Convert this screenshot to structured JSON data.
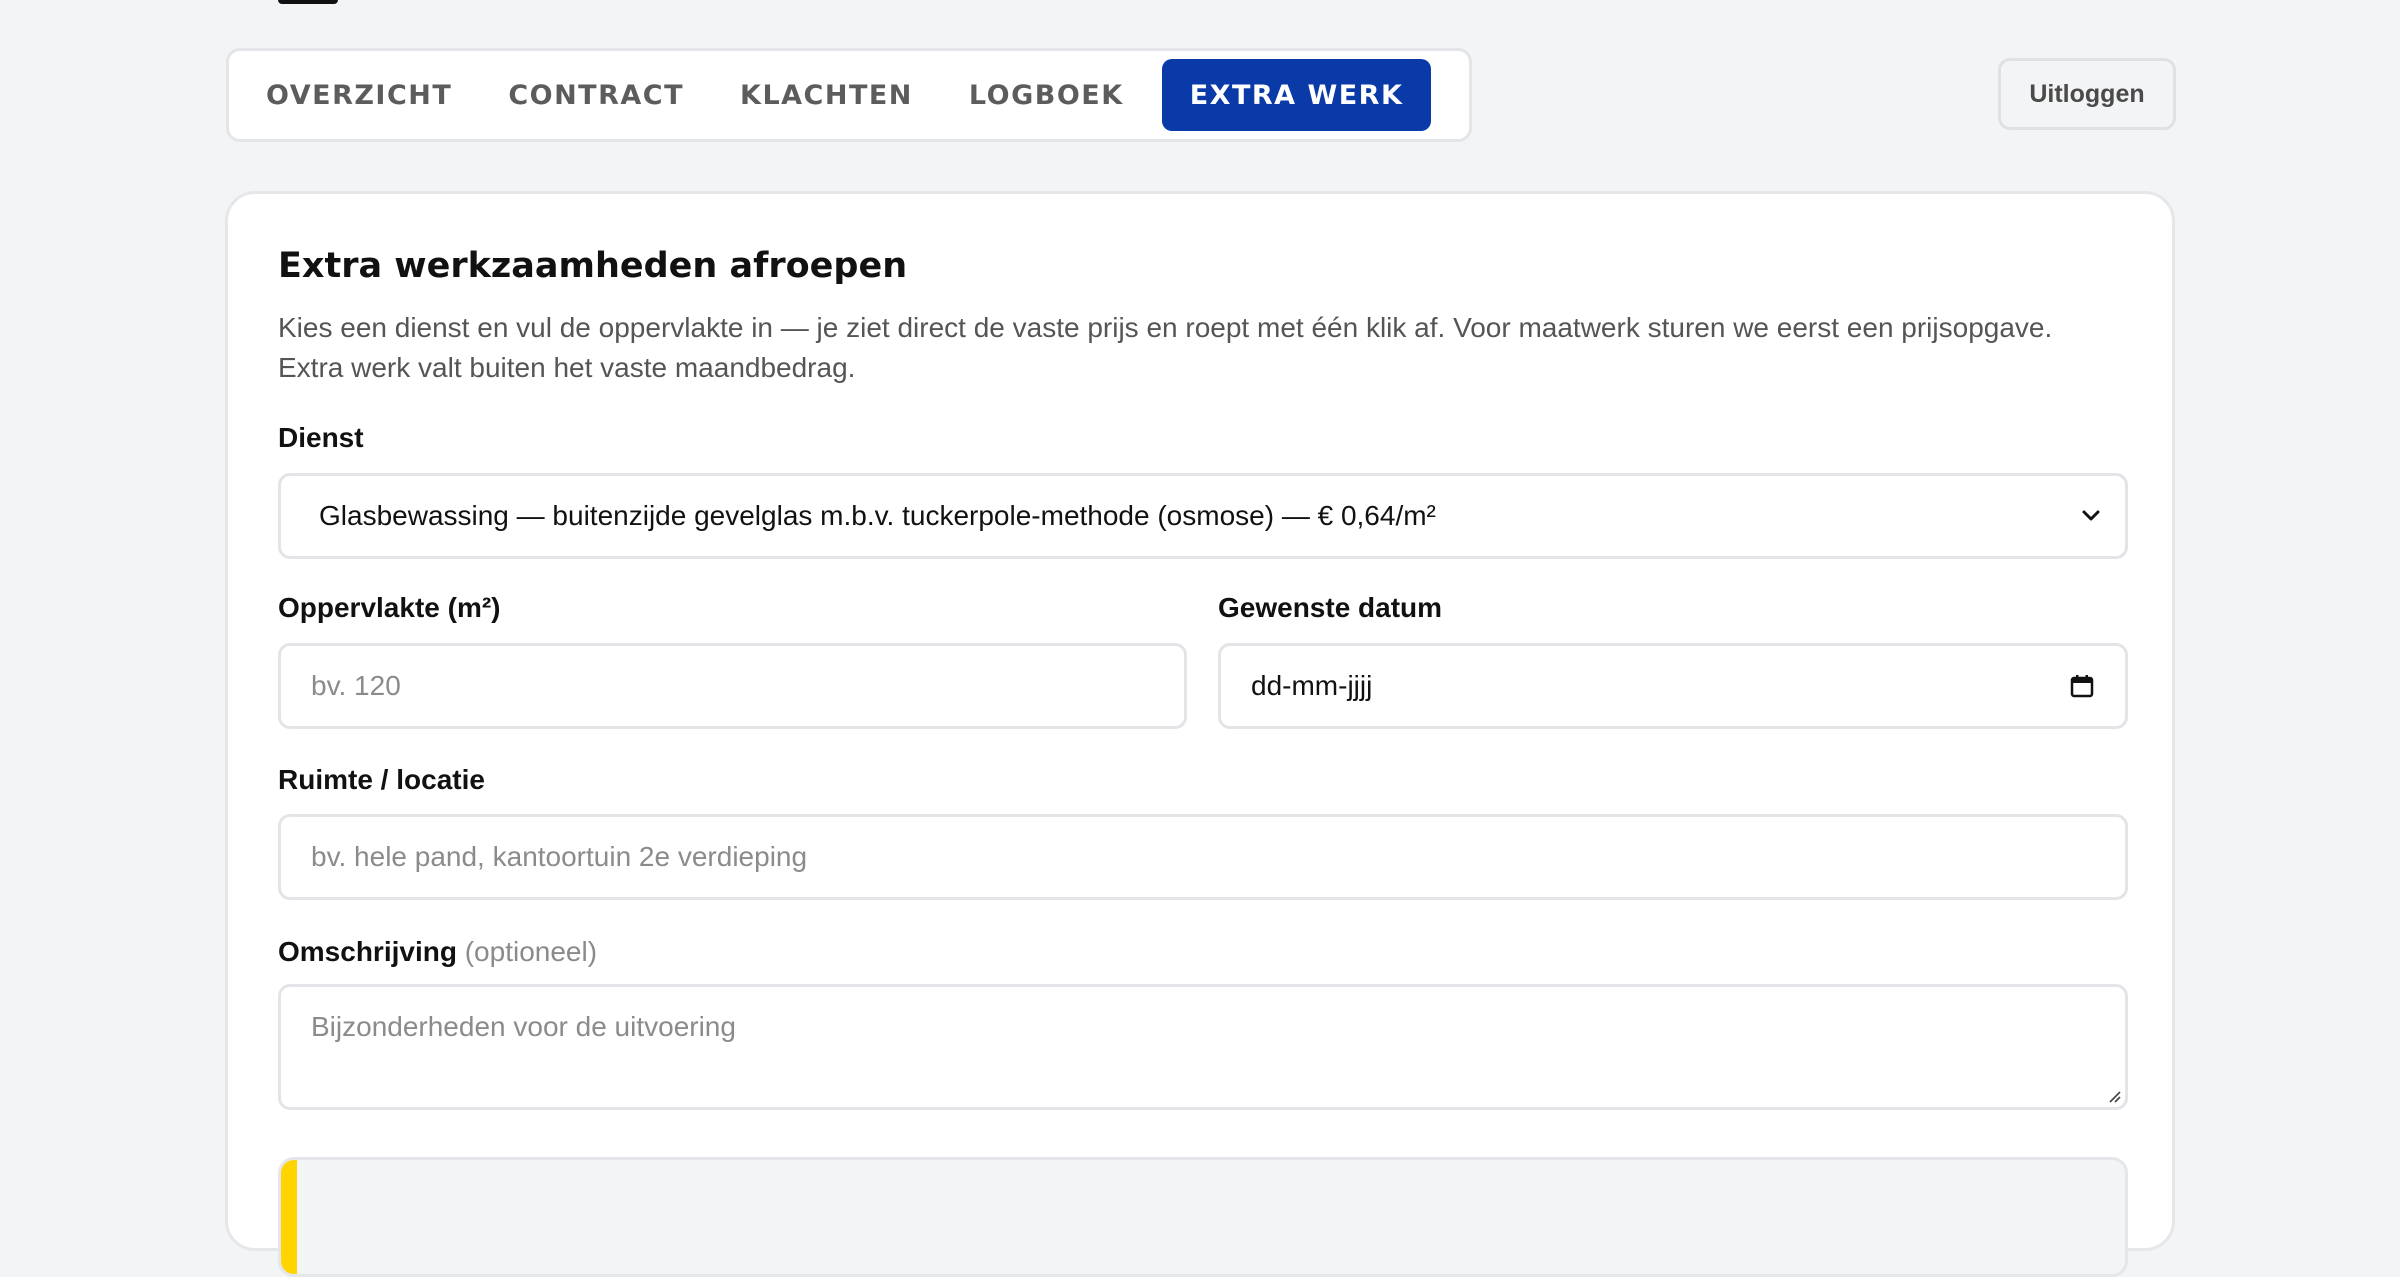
{
  "tabs": [
    {
      "label": "OVERZICHT",
      "active": false
    },
    {
      "label": "CONTRACT",
      "active": false
    },
    {
      "label": "KLACHTEN",
      "active": false
    },
    {
      "label": "LOGBOEK",
      "active": false
    },
    {
      "label": "EXTRA WERK",
      "active": true
    }
  ],
  "header": {
    "logout_label": "Uitloggen"
  },
  "colors": {
    "accent": "#0a3aa7",
    "notice_bar": "#ffd400",
    "background": "#f3f4f6"
  },
  "form": {
    "title": "Extra werkzaamheden afroepen",
    "intro": "Kies een dienst en vul de oppervlakte in — je ziet direct de vaste prijs en roept met één klik af. Voor maatwerk sturen we eerst een prijsopgave. Extra werk valt buiten het vaste maandbedrag.",
    "service": {
      "label": "Dienst",
      "selected": "Glasbewassing — buitenzijde gevelglas m.b.v. tuckerpole-methode (osmose) — € 0,64/m²"
    },
    "area": {
      "label": "Oppervlakte (m²)",
      "placeholder": "bv. 120"
    },
    "date": {
      "label": "Gewenste datum",
      "placeholder": "dd-mm-jjjj"
    },
    "location": {
      "label": "Ruimte / locatie",
      "placeholder": "bv. hele pand, kantoortuin 2e verdieping"
    },
    "description": {
      "label": "Omschrijving",
      "optional": "(optioneel)",
      "placeholder": "Bijzonderheden voor de uitvoering"
    }
  }
}
